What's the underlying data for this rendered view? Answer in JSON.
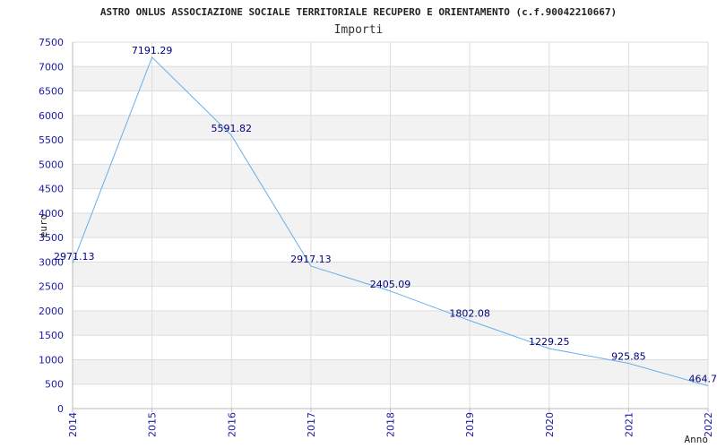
{
  "chart_data": {
    "type": "line",
    "title": "ASTRO ONLUS ASSOCIAZIONE SOCIALE TERRITORIALE RECUPERO E ORIENTAMENTO (c.f.90042210667)",
    "subtitle": "Importi",
    "xlabel": "Anno",
    "ylabel": "euro",
    "x": [
      "2014",
      "2015",
      "2016",
      "2017",
      "2018",
      "2019",
      "2020",
      "2021",
      "2022"
    ],
    "values": [
      2971.13,
      7191.29,
      5591.82,
      2917.13,
      2405.09,
      1802.08,
      1229.25,
      925.85,
      464.7
    ],
    "value_labels": [
      "2971.13",
      "7191.29",
      "5591.82",
      "2917.13",
      "2405.09",
      "1802.08",
      "1229.25",
      "925.85",
      "464.7"
    ],
    "yticks": [
      "0",
      "500",
      "1000",
      "1500",
      "2000",
      "2500",
      "3000",
      "3500",
      "4000",
      "4500",
      "5000",
      "5500",
      "6000",
      "6500",
      "7000",
      "7500"
    ],
    "ylim": [
      0,
      7500
    ],
    "grid": true,
    "colors": {
      "line": "#6aaee8",
      "band": "#f2f2f2",
      "grid": "#dddddd",
      "tick": "#1a1aa6",
      "label": "#000080"
    }
  }
}
